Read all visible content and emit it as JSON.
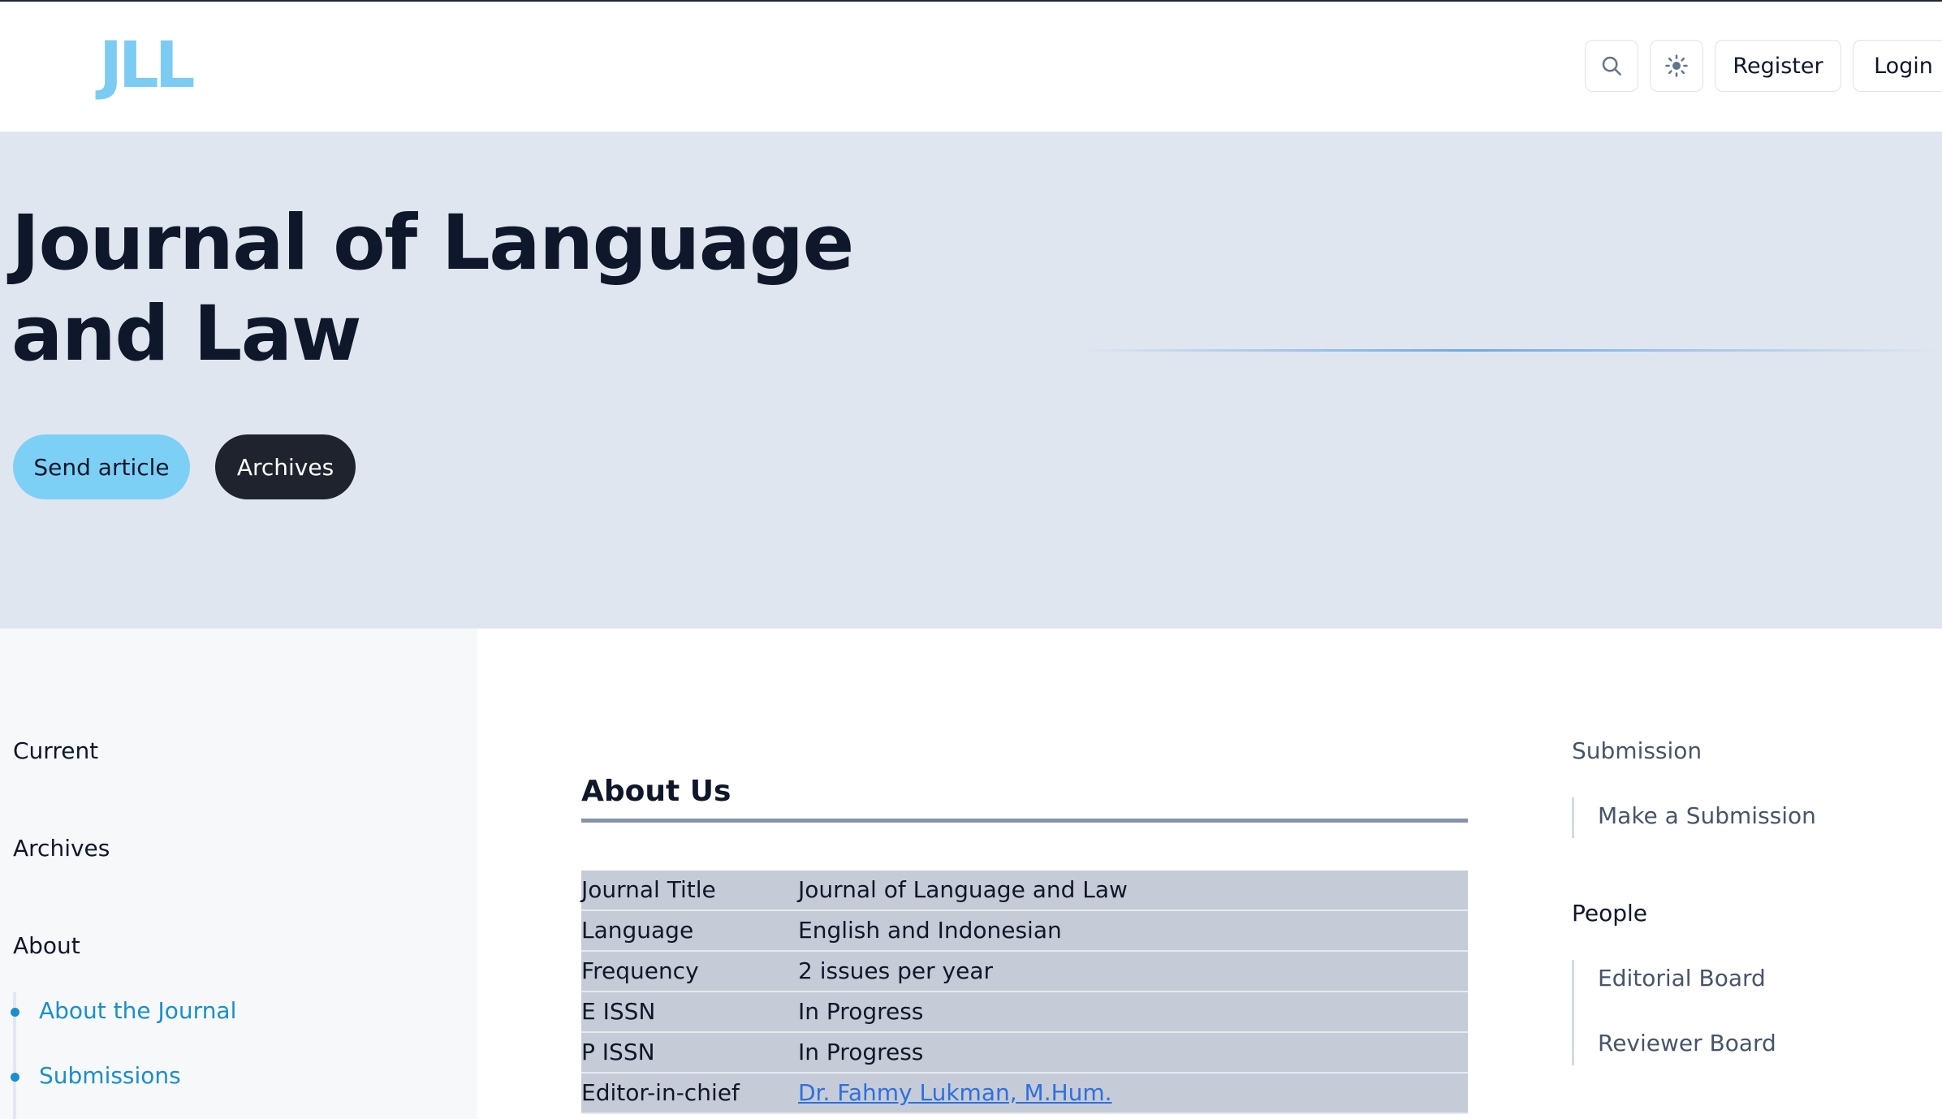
{
  "header": {
    "logo": "JLL",
    "search_icon": "search-icon",
    "theme_icon": "sun-icon",
    "register_label": "Register",
    "login_label": "Login"
  },
  "hero": {
    "title": "Journal of Language and Law",
    "send_label": "Send article",
    "archives_label": "Archives"
  },
  "sidebar": {
    "items": [
      {
        "label": "Current"
      },
      {
        "label": "Archives"
      },
      {
        "label": "About"
      }
    ],
    "about_sub": [
      {
        "label": "About the Journal"
      },
      {
        "label": "Submissions"
      }
    ]
  },
  "main": {
    "heading": "About Us",
    "table": [
      {
        "label": "Journal Title",
        "value": "Journal of Language and Law"
      },
      {
        "label": "Language",
        "value": "English and Indonesian"
      },
      {
        "label": "Frequency",
        "value": "2 issues per year"
      },
      {
        "label": "E ISSN",
        "value": "In Progress"
      },
      {
        "label": "P ISSN",
        "value": "In Progress"
      },
      {
        "label": "Editor-in-chief",
        "value": "Dr. Fahmy Lukman, M.Hum."
      }
    ]
  },
  "right_sidebar": {
    "submission_heading": "Submission",
    "make_submission": "Make a Submission",
    "people_heading": "People",
    "editorial_board": "Editorial Board",
    "reviewer_board": "Reviewer Board"
  },
  "colors": {
    "logo": "#7ccbf2",
    "accent_link": "#1a8fcb",
    "send_button": "#7dd0f5",
    "archives_button": "#1e232e",
    "hero_bg": "#e0e6ef",
    "table_row": "#c5ccd7"
  }
}
